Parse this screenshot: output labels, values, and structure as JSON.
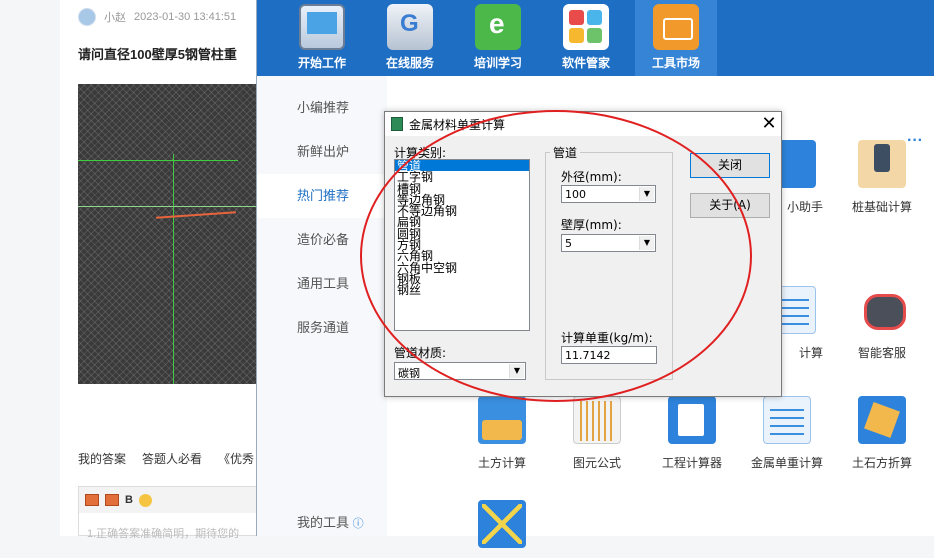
{
  "forum": {
    "user": "小赵",
    "time": "2023-01-30 13:41:51",
    "question": "请问直径100壁厚5钢管柱重",
    "tabs": [
      "我的答案",
      "答题人必看",
      "《优秀"
    ],
    "editor_bold": "B",
    "editor_placeholder": "1.正确答案准确简明，期待您的"
  },
  "app": {
    "nav": [
      {
        "label": "开始工作",
        "icon": "monitor-icon"
      },
      {
        "label": "在线服务",
        "icon": "online-service-icon"
      },
      {
        "label": "培训学习",
        "icon": "ie-icon"
      },
      {
        "label": "软件管家",
        "icon": "software-manager-icon"
      },
      {
        "label": "工具市场",
        "icon": "toolbox-icon",
        "active": true
      }
    ],
    "sidebar": [
      {
        "label": "小编推荐"
      },
      {
        "label": "新鲜出炉"
      },
      {
        "label": "热门推荐",
        "active": true
      },
      {
        "label": "造价必备"
      },
      {
        "label": "通用工具"
      },
      {
        "label": "服务通道"
      }
    ],
    "my_tools": "我的工具",
    "more": "···",
    "tools": [
      {
        "label": "小助手",
        "icon": "assistant-icon"
      },
      {
        "label": "桩基础计算",
        "icon": "pile-foundation-icon"
      },
      {
        "label": "计算",
        "icon": "calc-table-icon"
      },
      {
        "label": "智能客服",
        "icon": "robot-icon"
      },
      {
        "label": "土方计算",
        "icon": "earthwork-icon"
      },
      {
        "label": "图元公式",
        "icon": "ruler-icon"
      },
      {
        "label": "工程计算器",
        "icon": "calculator-icon"
      },
      {
        "label": "金属单重计算",
        "icon": "metal-weight-icon"
      },
      {
        "label": "土石方折算",
        "icon": "stone-convert-icon"
      },
      {
        "label": "",
        "icon": "cross-grid-icon"
      }
    ]
  },
  "dialog": {
    "title": "金属材料单重计算",
    "close_glyph": "✕",
    "type_label": "计算类别:",
    "types": [
      "管道",
      "工字钢",
      "槽钢",
      "等边角钢",
      "不等边角钢",
      "扁钢",
      "圆钢",
      "方钢",
      "六角钢",
      "六角中空钢",
      "钢板",
      "钢丝"
    ],
    "selected_type": "管道",
    "material_label": "管道材质:",
    "material_value": "碳钢",
    "group_title": "管道",
    "outer_label": "外径(mm):",
    "outer_value": "100",
    "wall_label": "壁厚(mm):",
    "wall_value": "5",
    "unit_weight_label": "计算单重(kg/m):",
    "unit_weight_value": "11.7142",
    "btn_close": "关闭",
    "btn_about": "关于(A)"
  },
  "colors": {
    "topbar": "#1e6fc4",
    "annotation_circle": "#e02020",
    "selection": "#0078d7"
  }
}
